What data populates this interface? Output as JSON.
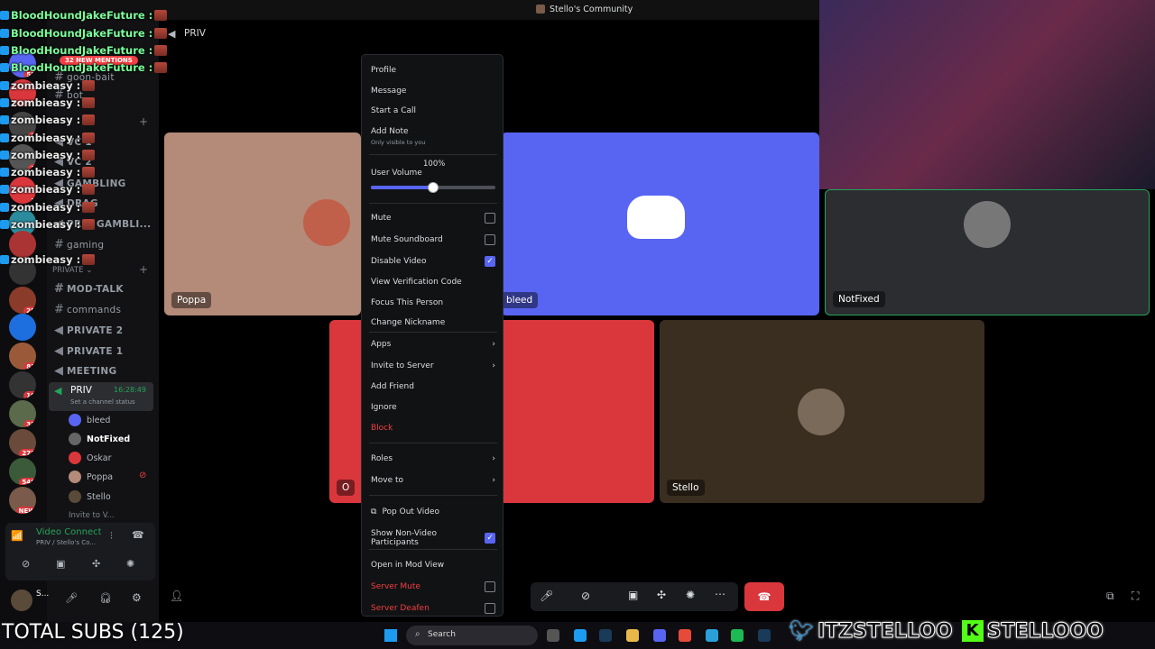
{
  "window": {
    "title": "Stello's Community",
    "channel_header": "PRIV"
  },
  "chat_overlay": [
    {
      "user": "BloodHoundJakeFuture :",
      "color": "#7cff9a"
    },
    {
      "user": "BloodHoundJakeFuture :",
      "color": "#7cff9a"
    },
    {
      "user": "BloodHoundJakeFuture :",
      "color": "#7cff9a"
    },
    {
      "user": "BloodHoundJakeFuture :",
      "color": "#7cff9a"
    },
    {
      "user": "zombieasy :",
      "color": "#e8e8e8"
    },
    {
      "user": "zombieasy :",
      "color": "#e8e8e8"
    },
    {
      "user": "zombieasy :",
      "color": "#e8e8e8"
    },
    {
      "user": "zombieasy :",
      "color": "#e8e8e8"
    },
    {
      "user": "zombieasy :",
      "color": "#e8e8e8"
    },
    {
      "user": "zombieasy :",
      "color": "#e8e8e8"
    },
    {
      "user": "zombieasy :",
      "color": "#e8e8e8"
    },
    {
      "user": "zombieasy :",
      "color": "#e8e8e8"
    },
    {
      "user": "zombieasy :",
      "color": "#e8e8e8"
    },
    {
      "user": "zombieasy :",
      "color": "#e8e8e8"
    }
  ],
  "new_mentions": "32 NEW MENTIONS",
  "channels": {
    "items": [
      "goon-bait",
      "bot",
      "VC 1",
      "VC 2",
      "GAMBLING",
      "DRAG",
      "PRIV GAMBLI...",
      "gaming"
    ],
    "category_private": "PRIVATE",
    "private_items": [
      "MOD-TALK",
      "commands",
      "PRIVATE 2",
      "PRIVATE 1",
      "MEETING"
    ],
    "active_voice": "PRIV",
    "active_timer": "16:28:49",
    "channel_status": "Set a channel status",
    "members": [
      "bleed",
      "NotFixed",
      "Oskar",
      "Poppa",
      "Stello"
    ],
    "invite": "Invite to V..."
  },
  "server_badges": [
    "53",
    "1",
    "1",
    "1",
    "1",
    "25",
    "81",
    "10",
    "32",
    "272",
    "548",
    "NEW"
  ],
  "voice_panel": {
    "status": "Video Connected",
    "sub": "PRIV / Stello's Co...",
    "user": "S..."
  },
  "tiles": [
    {
      "name": "Poppa",
      "bg": "#b48a78"
    },
    {
      "name": "bleed",
      "bg": "#5865f2"
    },
    {
      "name": "NotFixed",
      "bg": "#2b2d31"
    },
    {
      "name": "O",
      "bg": "#da373c"
    },
    {
      "name": "Stello",
      "bg": "#3a2e20"
    }
  ],
  "menu": {
    "profile": "Profile",
    "message": "Message",
    "start_call": "Start a Call",
    "add_note": "Add Note",
    "add_note_sub": "Only visible to you",
    "user_volume": "User Volume",
    "volume_value": "100%",
    "volume_fraction": 0.5,
    "mute": "Mute",
    "mute_soundboard": "Mute Soundboard",
    "disable_video": "Disable Video",
    "view_verification": "View Verification Code",
    "focus_person": "Focus This Person",
    "change_nickname": "Change Nickname",
    "apps": "Apps",
    "invite_server": "Invite to Server",
    "add_friend": "Add Friend",
    "ignore": "Ignore",
    "block": "Block",
    "roles": "Roles",
    "move_to": "Move to",
    "pop_out": "Pop Out Video",
    "show_non_video": "Show Non-Video Participants",
    "open_mod_view": "Open in Mod View",
    "server_mute": "Server Mute",
    "server_deafen": "Server Deafen"
  },
  "taskbar": {
    "search": "Search"
  },
  "overlay_text": {
    "subs": "TOTAL SUBS (125)",
    "twitter": "ITZSTELLOO",
    "kick": "STELLOOO"
  }
}
